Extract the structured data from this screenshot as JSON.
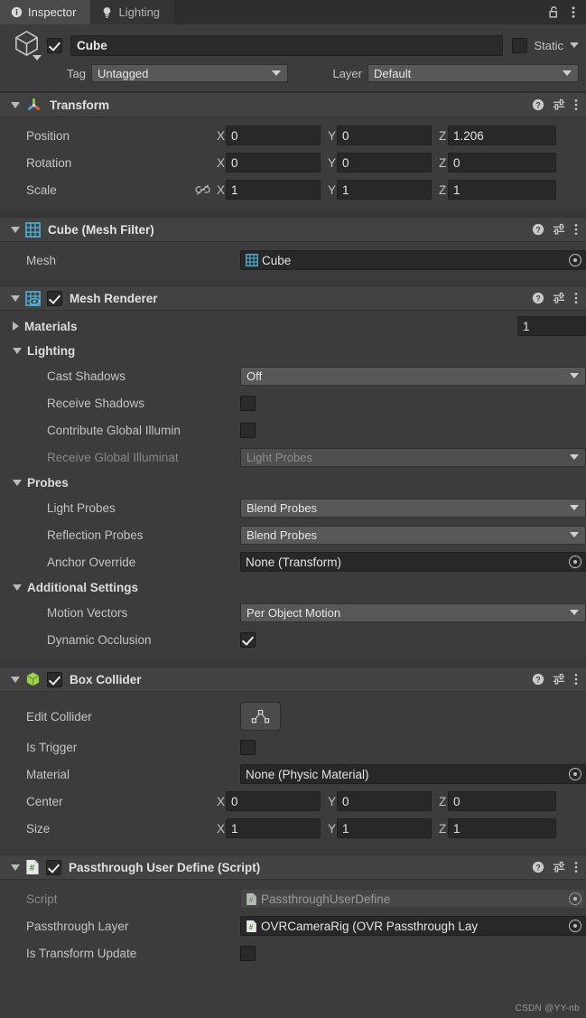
{
  "window": {
    "tabs": [
      {
        "label": "Inspector",
        "icon": "info-icon",
        "active": true
      },
      {
        "label": "Lighting",
        "icon": "lightbulb-icon",
        "active": false
      }
    ],
    "lock_icon": "padlock-open-icon",
    "menu_icon": "kebab-menu-icon"
  },
  "gameobject": {
    "icon": "cube-outline-icon",
    "enabled": true,
    "name": "Cube",
    "static_label": "Static",
    "static_checked": false,
    "tag_label": "Tag",
    "tag_value": "Untagged",
    "layer_label": "Layer",
    "layer_value": "Default"
  },
  "components": [
    {
      "id": "transform",
      "title": "Transform",
      "icon": "transform-axis-icon",
      "has_checkbox": false,
      "expanded": true,
      "rows": [
        {
          "label": "Position",
          "x": "0",
          "y": "0",
          "z": "1.206"
        },
        {
          "label": "Rotation",
          "x": "0",
          "y": "0",
          "z": "0"
        },
        {
          "label": "Scale",
          "x": "1",
          "y": "1",
          "z": "1",
          "link_icon": "link-broken-icon"
        }
      ]
    },
    {
      "id": "mesh-filter",
      "title": "Cube (Mesh Filter)",
      "icon": "mesh-grid-icon",
      "has_checkbox": false,
      "expanded": true,
      "mesh_label": "Mesh",
      "mesh_value": "Cube",
      "mesh_value_icon": "mesh-grid-icon"
    },
    {
      "id": "mesh-renderer",
      "title": "Mesh Renderer",
      "icon": "mesh-renderer-icon",
      "has_checkbox": true,
      "checked": true,
      "expanded": true,
      "materials_label": "Materials",
      "materials_count": "1",
      "groups": [
        {
          "name": "Lighting",
          "rows": [
            {
              "label": "Cast Shadows",
              "type": "dropdown",
              "value": "Off"
            },
            {
              "label": "Receive Shadows",
              "type": "checkbox",
              "checked": false
            },
            {
              "label": "Contribute Global Illumin",
              "type": "checkbox",
              "checked": false
            },
            {
              "label": "Receive Global Illuminat",
              "type": "dropdown",
              "value": "Light Probes",
              "disabled": true
            }
          ]
        },
        {
          "name": "Probes",
          "rows": [
            {
              "label": "Light Probes",
              "type": "dropdown",
              "value": "Blend Probes"
            },
            {
              "label": "Reflection Probes",
              "type": "dropdown",
              "value": "Blend Probes"
            },
            {
              "label": "Anchor Override",
              "type": "object",
              "value": "None (Transform)"
            }
          ]
        },
        {
          "name": "Additional Settings",
          "rows": [
            {
              "label": "Motion Vectors",
              "type": "dropdown",
              "value": "Per Object Motion"
            },
            {
              "label": "Dynamic Occlusion",
              "type": "checkbox",
              "checked": true
            }
          ]
        }
      ]
    },
    {
      "id": "box-collider",
      "title": "Box Collider",
      "icon": "box-collider-icon",
      "has_checkbox": true,
      "checked": true,
      "expanded": true,
      "rows": [
        {
          "label": "Edit Collider",
          "type": "editbutton",
          "icon": "edit-collider-icon"
        },
        {
          "label": "Is Trigger",
          "type": "checkbox",
          "checked": false
        },
        {
          "label": "Material",
          "type": "object",
          "value": "None (Physic Material)"
        },
        {
          "label": "Center",
          "type": "vector3",
          "x": "0",
          "y": "0",
          "z": "0"
        },
        {
          "label": "Size",
          "type": "vector3",
          "x": "1",
          "y": "1",
          "z": "1"
        }
      ]
    },
    {
      "id": "passthrough-user-define",
      "title": "Passthrough User Define (Script)",
      "icon": "cs-script-icon",
      "has_checkbox": true,
      "checked": true,
      "expanded": true,
      "rows": [
        {
          "label": "Script",
          "type": "object",
          "value": "PassthroughUserDefine",
          "icon": "cs-script-icon",
          "disabled": true
        },
        {
          "label": "Passthrough Layer",
          "type": "object",
          "value": "OVRCameraRig (OVR Passthrough Lay",
          "icon": "cs-script-icon"
        },
        {
          "label": "Is Transform Update",
          "type": "checkbox",
          "checked": false
        }
      ]
    }
  ],
  "header_icons": {
    "help": "help-circle-icon",
    "preset": "preset-settings-icon",
    "menu": "kebab-menu-icon"
  },
  "watermark": "CSDN @YY-nb",
  "colors": {
    "panel_bg": "#3c3c3c",
    "header_bg": "#424242",
    "field_bg": "#282828",
    "dropdown_bg": "#585858",
    "tab_active": "#4a4a4a",
    "accent_blue": "#4ec3f0",
    "accent_green": "#9ad44b"
  }
}
